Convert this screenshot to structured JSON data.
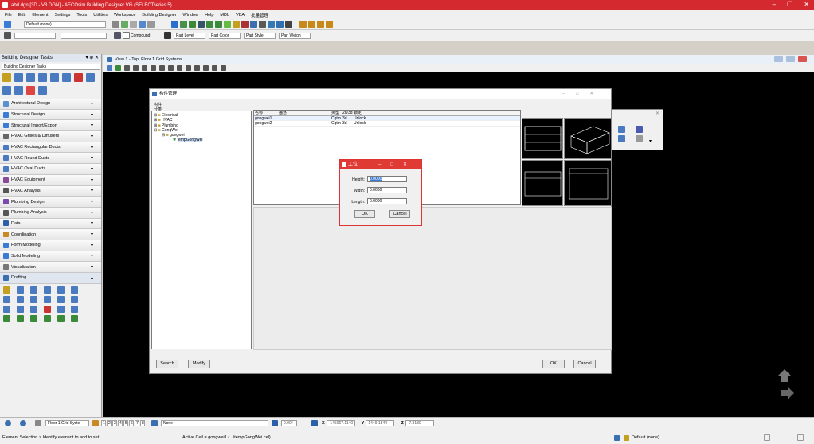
{
  "window": {
    "title": "abd.dgn [3D - V8 DGN] - AECOsim Building Designer V8i (SELECTseries 5)"
  },
  "menu": [
    "File",
    "Edit",
    "Element",
    "Settings",
    "Tools",
    "Utilities",
    "Workspace",
    "Building Designer",
    "Window",
    "Help",
    "MDL",
    "VBA",
    "批量管理"
  ],
  "toolbar": {
    "level_dropdown": "Default (none)",
    "compound_label": "Compound",
    "part_level": "Part Level",
    "part_color": "Part Color",
    "part_style": "Part Style",
    "part_weight": "Part Weigh"
  },
  "left_panel": {
    "title": "Building Designer Tasks",
    "dropdown": "Building Designer Tasks",
    "categories": [
      "Architectural Design",
      "Structural Design",
      "Structural Import/Export",
      "HVAC Grilles & Diffusers",
      "HVAC Rectangular Ducts",
      "HVAC Round Ducts",
      "HVAC Oval Ducts",
      "HVAC Equipment",
      "HVAC Analysis",
      "Plumbing Design",
      "Plumbing Analysis",
      "Data",
      "Coordination",
      "Form Modeling",
      "Solid Modeling",
      "Visualization",
      "Drafting"
    ]
  },
  "view": {
    "title": "View 1 - Top, Floor 1 Grid Systems"
  },
  "dialog": {
    "title": "构件管理",
    "tab": "构件",
    "tree_header": "分类",
    "tree": [
      "Electrical",
      "HVAC",
      "Plumbing",
      "GongWei",
      "gongwei",
      "tempGongWei"
    ],
    "columns": [
      "名称",
      "描述",
      "类型",
      "2d/3d",
      "锁定"
    ],
    "rows": [
      [
        "gongwei1",
        "",
        "Cgtm",
        "3d",
        "Unlock"
      ],
      [
        "gongwei2",
        "",
        "Cgtm",
        "3d",
        "Unlock"
      ]
    ],
    "search_btn": "Search",
    "modify_btn": "Modify",
    "ok_btn": "OK",
    "cancel_btn": "Cancel"
  },
  "input_dialog": {
    "title": "工位",
    "height_label": "Height:",
    "height_value": "0.0000",
    "width_label": "Width:",
    "width_value": "0.0000",
    "length_label": "Length:",
    "length_value": "0.0000",
    "ok": "OK",
    "cancel": "Cancel"
  },
  "status": {
    "model": "Floor 1 Grid Syste",
    "views": [
      "1",
      "2",
      "3",
      "4",
      "5",
      "6",
      "7",
      "8"
    ],
    "none": "None",
    "angle": "0.00°",
    "x": "-145067.1140",
    "y": "1449.1844",
    "z": "-7.8180",
    "x_label": "X",
    "y_label": "Y",
    "z_label": "Z",
    "prompt_left": "Element Selection > Identify element to add to set",
    "prompt_mid": "Active Cell = gongwei1 (...\\tempGongWei.cel)",
    "level_status": "Default (none)"
  }
}
